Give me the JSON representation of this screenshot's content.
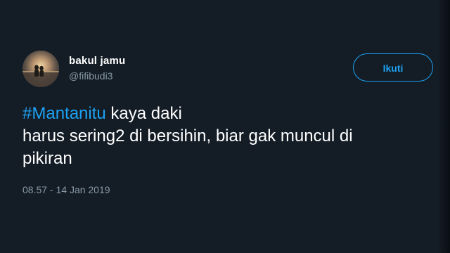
{
  "user": {
    "display_name": "bakul jamu",
    "handle": "@fifibudi3"
  },
  "follow_button": {
    "label": "Ikuti"
  },
  "tweet": {
    "hashtag": "#Mantanitu",
    "text_after_hashtag": " kaya daki\nharus sering2 di bersihin, biar gak muncul di\npikiran",
    "timestamp": "08.57 - 14 Jan 2019"
  },
  "colors": {
    "background": "#141d26",
    "accent": "#1da1f2",
    "muted": "#8899a6",
    "text": "#ffffff"
  },
  "icons": {
    "avatar": "profile-photo"
  }
}
